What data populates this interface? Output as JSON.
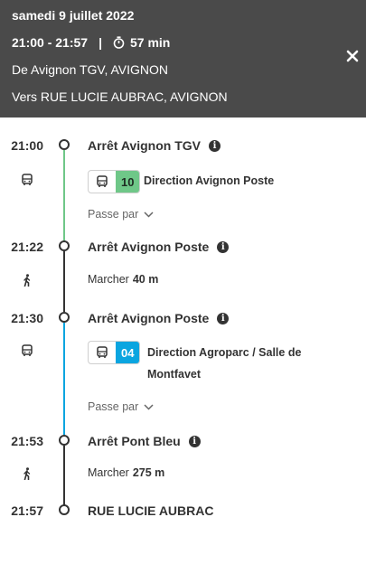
{
  "header": {
    "date": "samedi 9 juillet 2022",
    "time_range": "21:00 - 21:57",
    "separator": "|",
    "duration": "57 min",
    "from": "De Avignon TGV, AVIGNON",
    "to": "Vers RUE LUCIE AUBRAC, AVIGNON"
  },
  "colors": {
    "header_bg": "#4a4a4a",
    "line_10": "#6fc788",
    "line_04": "#0aa5e0",
    "line_dark": "#333333"
  },
  "steps": [
    {
      "time": "21:00",
      "stop": "Arrêt Avignon TGV"
    },
    {
      "time": "21:22",
      "stop": "Arrêt Avignon Poste"
    },
    {
      "time": "21:30",
      "stop": "Arrêt Avignon Poste"
    },
    {
      "time": "21:53",
      "stop": "Arrêt Pont Bleu"
    },
    {
      "time": "21:57",
      "stop": "RUE LUCIE AUBRAC"
    }
  ],
  "legs": [
    {
      "type": "bus",
      "line": "10",
      "direction": "Direction Avignon Poste",
      "passe_par": "Passe par"
    },
    {
      "type": "walk",
      "label": "Marcher",
      "distance": "40 m"
    },
    {
      "type": "bus",
      "line": "04",
      "direction_line1": "Direction Agroparc / Salle de",
      "direction_line2": "Montfavet",
      "passe_par": "Passe par"
    },
    {
      "type": "walk",
      "label": "Marcher",
      "distance": "275 m"
    }
  ],
  "icons": {
    "info": "i",
    "close": "close-icon",
    "bus": "bus-icon",
    "walk": "walk-icon",
    "timer": "timer-icon",
    "chevron": "chevron-down-icon"
  }
}
